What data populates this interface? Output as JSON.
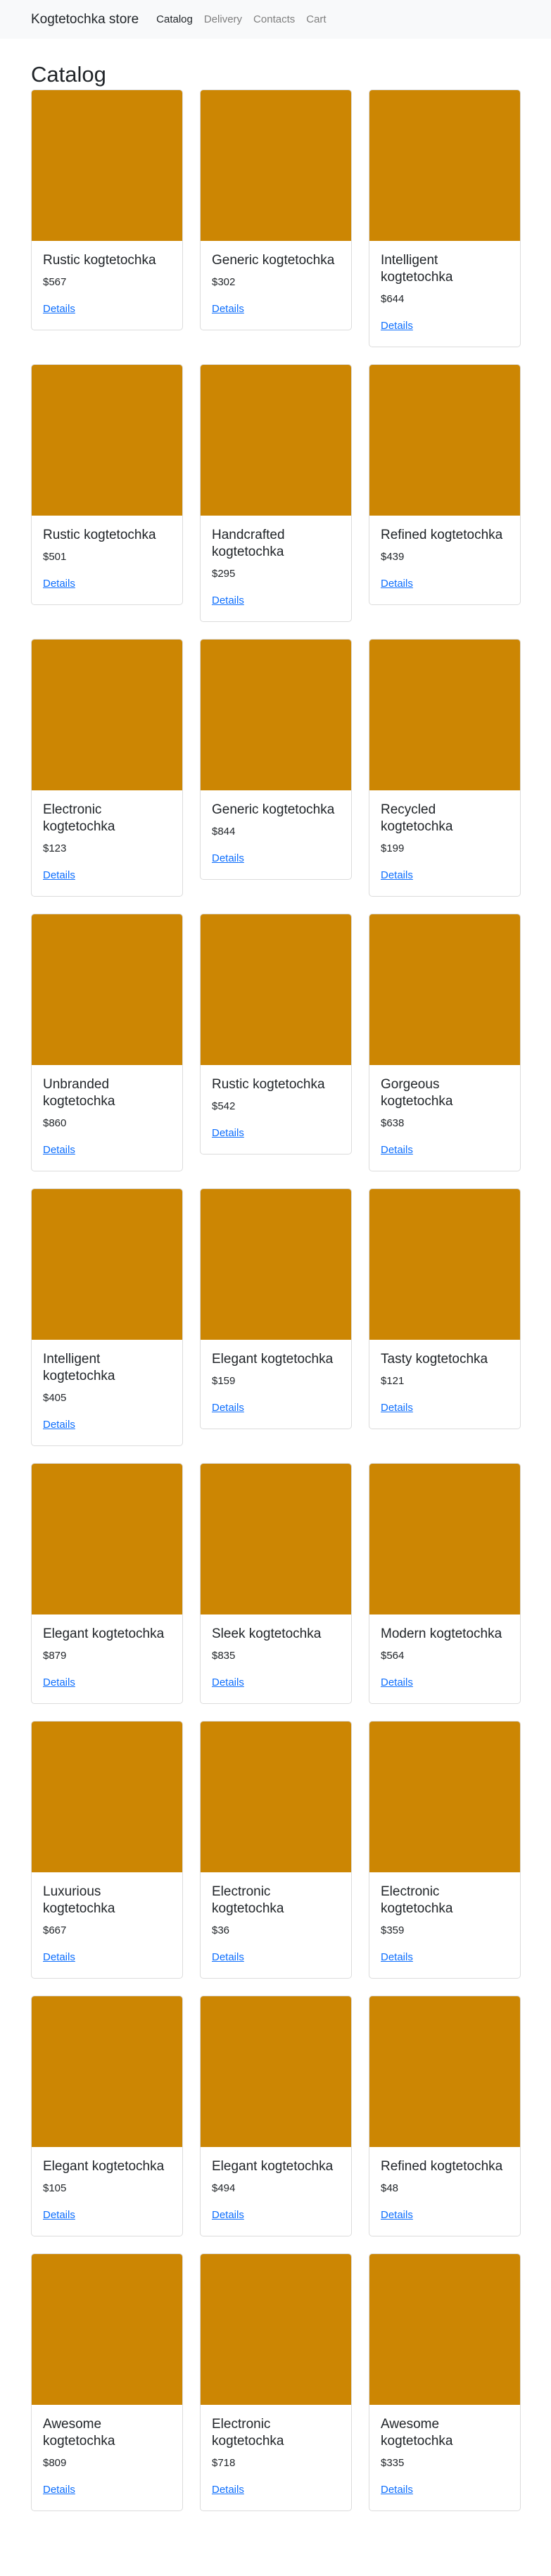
{
  "nav": {
    "brand": "Kogtetochka store",
    "links": [
      {
        "label": "Catalog",
        "active": true
      },
      {
        "label": "Delivery",
        "active": false
      },
      {
        "label": "Contacts",
        "active": false
      },
      {
        "label": "Cart",
        "active": false
      }
    ]
  },
  "page": {
    "title": "Catalog",
    "details_label": "Details"
  },
  "colors": {
    "image_placeholder": "#cc8603",
    "link": "#0d6efd"
  },
  "products": [
    {
      "name": "Rustic kogtetochka",
      "price": "$567"
    },
    {
      "name": "Generic kogtetochka",
      "price": "$302"
    },
    {
      "name": "Intelligent kogtetochka",
      "price": "$644"
    },
    {
      "name": "Rustic kogtetochka",
      "price": "$501"
    },
    {
      "name": "Handcrafted kogtetochka",
      "price": "$295"
    },
    {
      "name": "Refined kogtetochka",
      "price": "$439"
    },
    {
      "name": "Electronic kogtetochka",
      "price": "$123"
    },
    {
      "name": "Generic kogtetochka",
      "price": "$844"
    },
    {
      "name": "Recycled kogtetochka",
      "price": "$199"
    },
    {
      "name": "Unbranded kogtetochka",
      "price": "$860"
    },
    {
      "name": "Rustic kogtetochka",
      "price": "$542"
    },
    {
      "name": "Gorgeous kogtetochka",
      "price": "$638"
    },
    {
      "name": "Intelligent kogtetochka",
      "price": "$405"
    },
    {
      "name": "Elegant kogtetochka",
      "price": "$159"
    },
    {
      "name": "Tasty kogtetochka",
      "price": "$121"
    },
    {
      "name": "Elegant kogtetochka",
      "price": "$879"
    },
    {
      "name": "Sleek kogtetochka",
      "price": "$835"
    },
    {
      "name": "Modern kogtetochka",
      "price": "$564"
    },
    {
      "name": "Luxurious kogtetochka",
      "price": "$667"
    },
    {
      "name": "Electronic kogtetochka",
      "price": "$36"
    },
    {
      "name": "Electronic kogtetochka",
      "price": "$359"
    },
    {
      "name": "Elegant kogtetochka",
      "price": "$105"
    },
    {
      "name": "Elegant kogtetochka",
      "price": "$494"
    },
    {
      "name": "Refined kogtetochka",
      "price": "$48"
    },
    {
      "name": "Awesome kogtetochka",
      "price": "$809"
    },
    {
      "name": "Electronic kogtetochka",
      "price": "$718"
    },
    {
      "name": "Awesome kogtetochka",
      "price": "$335"
    }
  ]
}
